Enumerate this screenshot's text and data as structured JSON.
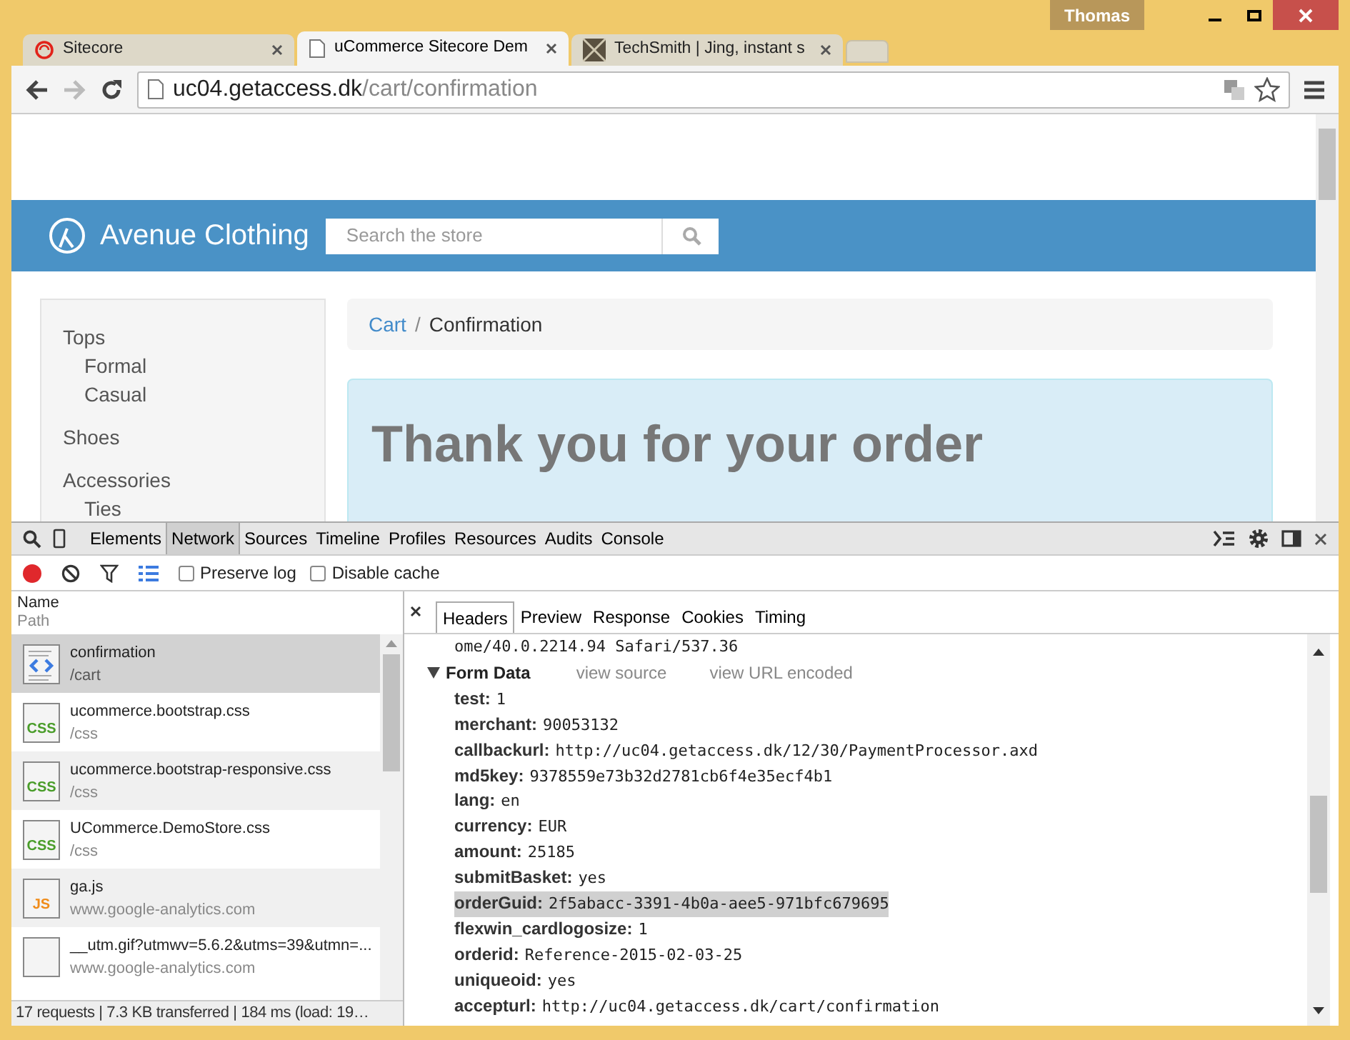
{
  "window": {
    "user": "Thomas"
  },
  "tabs": [
    {
      "title": "Sitecore",
      "kind": "ring",
      "selected": false
    },
    {
      "title": "uCommerce Sitecore Dem",
      "kind": "page",
      "selected": true
    },
    {
      "title": "TechSmith | Jing, instant s",
      "kind": "square",
      "selected": false
    }
  ],
  "address_bar": {
    "host": "uc04.getaccess.dk",
    "path": "/cart/confirmation"
  },
  "page": {
    "brand": "Avenue Clothing",
    "search_placeholder": "Search the store",
    "categories": [
      {
        "label": "Tops",
        "children": [
          {
            "label": "Formal"
          },
          {
            "label": "Casual"
          }
        ]
      },
      {
        "label": "Shoes"
      },
      {
        "label": "Accessories",
        "children": [
          {
            "label": "Ties"
          }
        ]
      }
    ],
    "breadcrumb": [
      {
        "label": "Cart",
        "kind": "link"
      },
      {
        "label": "Confirmation",
        "kind": "current"
      }
    ],
    "breadcrumb_separator": "/",
    "heading": "Thank you for your order"
  },
  "devtools": {
    "panels": [
      {
        "label": "Elements",
        "selected": false
      },
      {
        "label": "Network",
        "selected": true
      },
      {
        "label": "Sources",
        "selected": false
      },
      {
        "label": "Timeline",
        "selected": false
      },
      {
        "label": "Profiles",
        "selected": false
      },
      {
        "label": "Resources",
        "selected": false
      },
      {
        "label": "Audits",
        "selected": false
      },
      {
        "label": "Console",
        "selected": false
      }
    ],
    "recording": true,
    "options": [
      {
        "label": "Preserve log",
        "checked": false
      },
      {
        "label": "Disable cache",
        "checked": false
      }
    ],
    "columns": [
      "Name",
      "Path"
    ],
    "requests": [
      {
        "name": "confirmation",
        "path": "/cart",
        "kind": "html",
        "selected": true
      },
      {
        "name": "ucommerce.bootstrap.css",
        "path": "/css",
        "kind": "css",
        "badge": "CSS",
        "selected": false
      },
      {
        "name": "ucommerce.bootstrap-responsive.css",
        "path": "/css",
        "kind": "css",
        "badge": "CSS",
        "selected": false
      },
      {
        "name": "UCommerce.DemoStore.css",
        "path": "/css",
        "kind": "css",
        "badge": "CSS",
        "selected": false
      },
      {
        "name": "ga.js",
        "path": "www.google-analytics.com",
        "kind": "js",
        "badge": "JS",
        "selected": false
      },
      {
        "name": "__utm.gif?utmwv=5.6.2&utms=39&utmn=...",
        "path": "www.google-analytics.com",
        "kind": "image",
        "selected": false
      }
    ],
    "status": "17 requests | 7.3 KB transferred | 184 ms (load: 19…",
    "detail_tabs": [
      {
        "label": "Headers",
        "selected": true
      },
      {
        "label": "Preview",
        "selected": false
      },
      {
        "label": "Response",
        "selected": false
      },
      {
        "label": "Cookies",
        "selected": false
      },
      {
        "label": "Timing",
        "selected": false
      }
    ],
    "header_continuation": "ome/40.0.2214.94 Safari/537.36",
    "section": {
      "title": "Form Data",
      "expanded": true,
      "links": [
        "view source",
        "view URL encoded"
      ]
    },
    "form_data": [
      {
        "key": "test:",
        "value": "1",
        "selected": false
      },
      {
        "key": "merchant:",
        "value": "90053132",
        "selected": false
      },
      {
        "key": "callbackurl:",
        "value": "http://uc04.getaccess.dk/12/30/PaymentProcessor.axd",
        "selected": false
      },
      {
        "key": "md5key:",
        "value": "9378559e73b32d2781cb6f4e35ecf4b1",
        "selected": false
      },
      {
        "key": "lang:",
        "value": "en",
        "selected": false
      },
      {
        "key": "currency:",
        "value": "EUR",
        "selected": false
      },
      {
        "key": "amount:",
        "value": "25185",
        "selected": false
      },
      {
        "key": "submitBasket:",
        "value": "yes",
        "selected": false
      },
      {
        "key": "orderGuid:",
        "value": "2f5abacc-3391-4b0a-aee5-971bfc679695",
        "selected": true
      },
      {
        "key": "flexwin_cardlogosize:",
        "value": "1",
        "selected": false
      },
      {
        "key": "orderid:",
        "value": "Reference-2015-02-03-25",
        "selected": false
      },
      {
        "key": "uniqueoid:",
        "value": "yes",
        "selected": false
      },
      {
        "key": "accepturl:",
        "value": "http://uc04.getaccess.dk/cart/confirmation",
        "selected": false
      }
    ]
  }
}
